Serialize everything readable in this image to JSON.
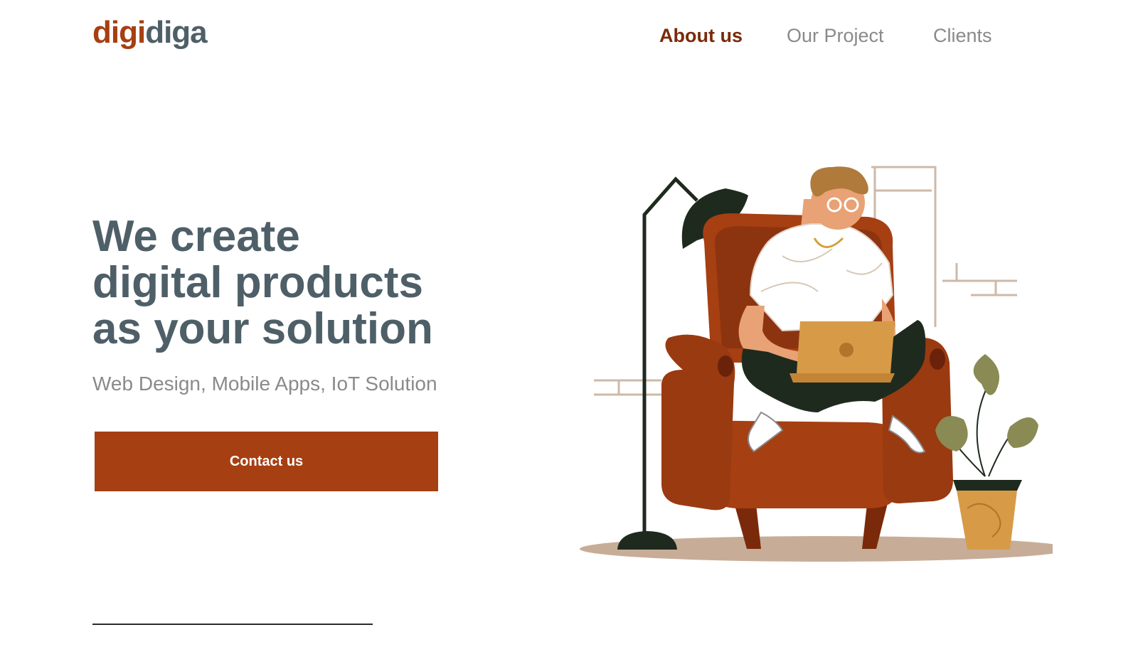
{
  "brand": {
    "part1": "digi",
    "part2": "diga",
    "color_primary": "#a63f12",
    "color_secondary": "#4e5f68"
  },
  "nav": {
    "items": [
      {
        "label": "About us",
        "active": true
      },
      {
        "label": "Our Project",
        "active": false
      },
      {
        "label": "Clients",
        "active": false
      }
    ]
  },
  "hero": {
    "title_lines": [
      "We create",
      "digital products",
      "as your solution"
    ],
    "subtitle": "Web Design, Mobile Apps, IoT Solution",
    "cta_label": "Contact us"
  },
  "colors": {
    "accent": "#a63f12",
    "text": "#4e5f68",
    "muted": "#8a8a8a"
  },
  "icons": [
    "floor-lamp-icon",
    "armchair-icon",
    "person-with-laptop-icon",
    "potted-plant-icon"
  ]
}
